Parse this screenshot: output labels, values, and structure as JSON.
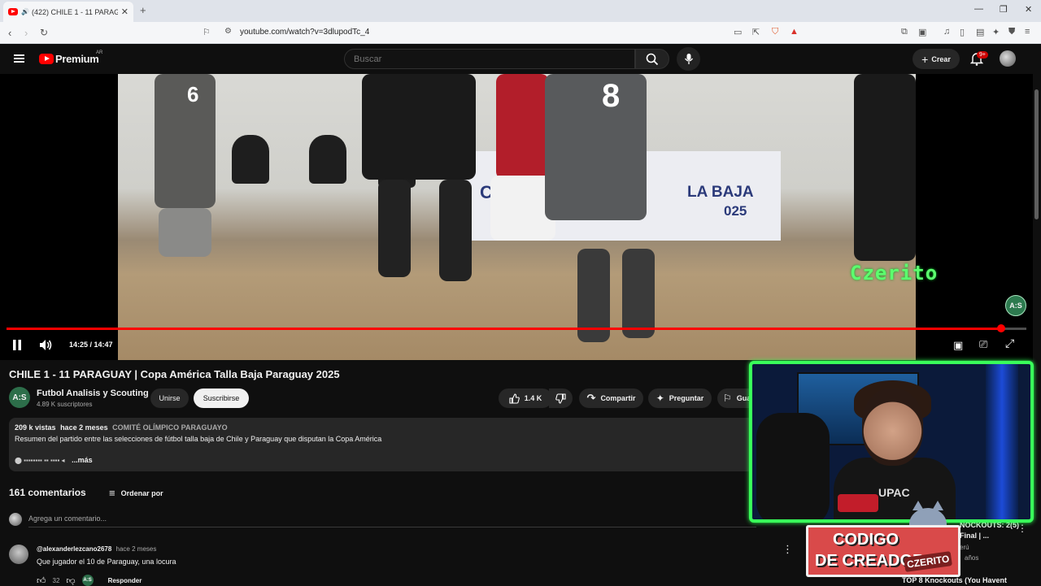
{
  "browser": {
    "tab_title": "(422) CHILE 1 - 11 PARAGUAY",
    "url": "youtube.com/watch?v=3dlupodTc_4"
  },
  "header": {
    "logo_text": "Premium",
    "region": "AR",
    "search_placeholder": "Buscar",
    "create_label": "Crear",
    "notifications_badge": "9+"
  },
  "player": {
    "time": "14:25 / 14:47",
    "progress": 0.975,
    "watermark": "A:S",
    "frame_banner": [
      "COPA",
      "LA BAJA",
      "025"
    ],
    "jersey_numbers": [
      "6",
      "8"
    ]
  },
  "overlay": {
    "streamer_name": "Czerito",
    "creator_code_line1": "CODIGO",
    "creator_code_line2": "DE CREADOR",
    "creator_code_tag": "CZERITO",
    "shirt_text": "UPAC"
  },
  "video": {
    "title": "CHILE 1 - 11 PARAGUAY | Copa América Talla Baja Paraguay 2025",
    "channel_avatar": "A:S",
    "channel_name": "Futbol Analisis y Scouting",
    "subscribers": "4.89 K suscriptores",
    "join_label": "Unirse",
    "subscribe_label": "Suscribirse",
    "likes": "1.4 K",
    "share_label": "Compartir",
    "ask_label": "Preguntar",
    "save_label": "Guar"
  },
  "description": {
    "views": "209 k vistas",
    "date": "hace 2 meses",
    "organization": "COMITÉ OLÍMPICO PARAGUAYO",
    "text": "Resumen del partido entre las selecciones de fútbol talla baja de Chile y Paraguay que disputan la Copa América",
    "tail_icons": "⬤ ▪▪▪▪▪▪▪▪ ▪▪ ▪▪▪▪ ◂",
    "more": "...más"
  },
  "comments": {
    "count": "161 comentarios",
    "sort_label": "Ordenar por",
    "add_placeholder": "Agrega un comentario...",
    "items": [
      {
        "user": "@alexanderlezcano2678",
        "when": "hace 2 meses",
        "text": "Que jugador el 10 de Paraguay, una locura",
        "likes": "32",
        "reply": "Responder",
        "hearted_by": "A:S"
      }
    ]
  },
  "sidebar": {
    "item1_title_a": "NOCKOUTS: 2(5)",
    "item1_title_b": "Final | ...",
    "item1_meta_a": "erú",
    "item1_meta_b": "años",
    "item2_title": "TOP 8 Knockouts (You Havent"
  }
}
